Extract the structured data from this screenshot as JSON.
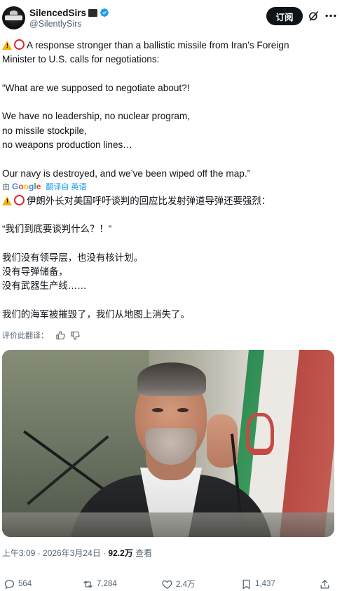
{
  "author": {
    "display_name": "SilencedSirs",
    "handle": "@SilentlySirs",
    "verified": true
  },
  "header": {
    "subscribe_label": "订阅",
    "icons": [
      "grok-icon",
      "more-icon"
    ]
  },
  "post": {
    "original_lines": [
      "A response stronger than a ballistic missile from Iran’s Foreign",
      "Minister to U.S. calls for negotiations:",
      "",
      "“What are we supposed to negotiate about?!",
      "",
      "We have no leadership, no nuclear program,",
      "no missile stockpile,",
      "no weapons production lines…",
      "",
      "Our navy is destroyed, and we’ve been wiped off the map.”"
    ],
    "translation": {
      "by_label": "由",
      "provider": "Google",
      "translated_from": "翻译自 英语"
    },
    "translated_lines": [
      "伊朗外长对美国呼吁谈判的回应比发射弹道导弹还要强烈：",
      "",
      "“我们到底要谈判什么？！”",
      "",
      "我们没有领导层，也没有核计划。",
      "没有导弹储备，",
      "没有武器生产线……",
      "",
      "我们的海军被摧毁了，我们从地图上消失了。"
    ],
    "rate_translation_label": "评价此翻译："
  },
  "meta": {
    "time": "上午3:09",
    "separator": " · ",
    "date": "2026年3月24日",
    "views_count": "92.2万",
    "views_label": " 查看"
  },
  "actions": {
    "replies": "564",
    "reposts": "7,284",
    "likes": "2.4万",
    "bookmarks": "1,437"
  },
  "colors": {
    "text": "#0f1419",
    "secondary": "#536471",
    "link": "#1d9bf0",
    "verified": "#1d9bf0",
    "button_bg": "#0f1419"
  }
}
